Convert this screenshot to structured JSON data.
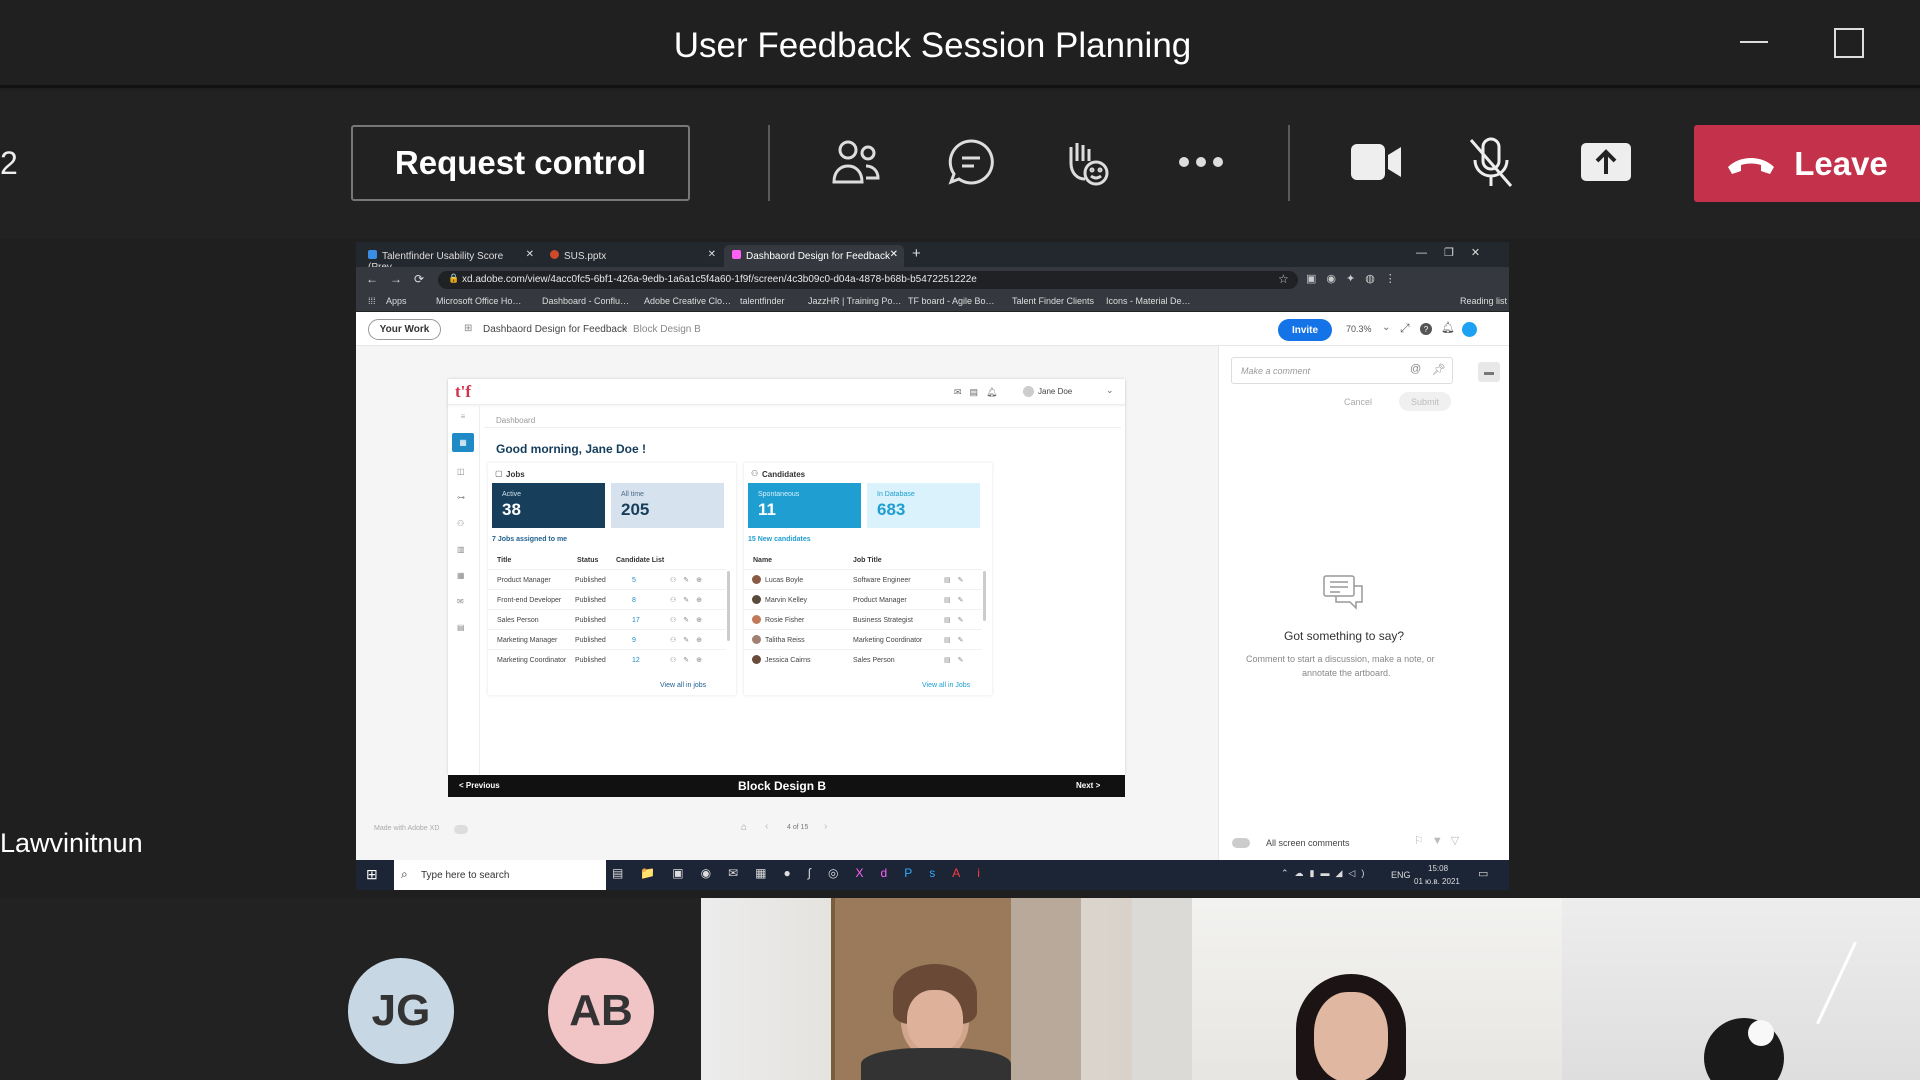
{
  "window": {
    "title": "User Feedback Session Planning"
  },
  "meeting": {
    "count_partial": "2",
    "request_control": "Request control",
    "leave": "Leave",
    "presenter_name": "Lawvinitnun"
  },
  "toolbar_icons": [
    "people-icon",
    "chat-icon",
    "raise-hand-icon",
    "more-icon",
    "camera-icon",
    "mic-off-icon",
    "share-icon",
    "phone-icon"
  ],
  "browser": {
    "tabs": [
      "Talentfinder Usability Score (Prev…",
      "SUS.pptx",
      "Dashbaord Design for Feedback"
    ],
    "url": "xd.adobe.com/view/4acc0fc5-6bf1-426a-9edb-1a6a1c5f4a60-1f9f/screen/4c3b09c0-d04a-4878-b68b-b5472251222e",
    "bookmarks": [
      "Apps",
      "Microsoft Office Ho…",
      "Dashboard - Conflu…",
      "Adobe Creative Clo…",
      "talentfinder",
      "JazzHR | Training Po…",
      "TF board - Agile Bo…",
      "Talent Finder Clients",
      "Icons - Material De…"
    ],
    "reading_list": "Reading list"
  },
  "xd": {
    "your_work": "Your Work",
    "breadcrumb_project": "Dashbaord Design for Feedback",
    "breadcrumb_screen": "Block Design B",
    "invite": "Invite",
    "zoom": "70.3%",
    "comment_placeholder": "Make a comment",
    "cancel": "Cancel",
    "submit": "Submit",
    "empty_title": "Got something to say?",
    "empty_text_1": "Comment to start a discussion, make a note, or",
    "empty_text_2": "annotate the artboard.",
    "all_comments": "All screen comments",
    "made_with": "Made with Adobe XD",
    "page_indicator": "4 of 15",
    "prev": "< Previous",
    "next": "Next >",
    "artboard_title": "Block Design B"
  },
  "dashboard": {
    "logo": "t'f",
    "user": "Jane Doe",
    "page": "Dashboard",
    "greeting": "Good morning, Jane Doe !",
    "jobs": {
      "title": "Jobs",
      "stats": [
        {
          "label": "Active",
          "value": "38"
        },
        {
          "label": "All time",
          "value": "205"
        }
      ],
      "assigned": "7 Jobs assigned to me",
      "headers": [
        "Title",
        "Status",
        "Candidate List"
      ],
      "rows": [
        [
          "Product Manager",
          "Published",
          "5"
        ],
        [
          "Front-end Developer",
          "Published",
          "8"
        ],
        [
          "Sales Person",
          "Published",
          "17"
        ],
        [
          "Marketing Manager",
          "Published",
          "9"
        ],
        [
          "Marketing Coordinator",
          "Published",
          "12"
        ]
      ],
      "view_all": "View all in jobs"
    },
    "candidates": {
      "title": "Candidates",
      "stats": [
        {
          "label": "Spontaneous",
          "value": "11"
        },
        {
          "label": "In Database",
          "value": "683"
        }
      ],
      "new": "15 New candidates",
      "headers": [
        "Name",
        "Job Title"
      ],
      "rows": [
        [
          "Lucas Boyle",
          "Software Engineer"
        ],
        [
          "Marvin Kelley",
          "Product Manager"
        ],
        [
          "Rosie Fisher",
          "Business Strategist"
        ],
        [
          "Talitha Reiss",
          "Marketing Coordinator"
        ],
        [
          "Jessica Cairns",
          "Sales Person"
        ]
      ],
      "view_all": "View all in Jobs"
    }
  },
  "taskbar": {
    "search": "Type here to search",
    "lang": "ENG",
    "time": "15:08",
    "date": "01 ю.в. 2021"
  },
  "participants": [
    {
      "initials": "JG",
      "color": "#c7d7e4"
    },
    {
      "initials": "AB",
      "color": "#f1c4c6"
    }
  ]
}
